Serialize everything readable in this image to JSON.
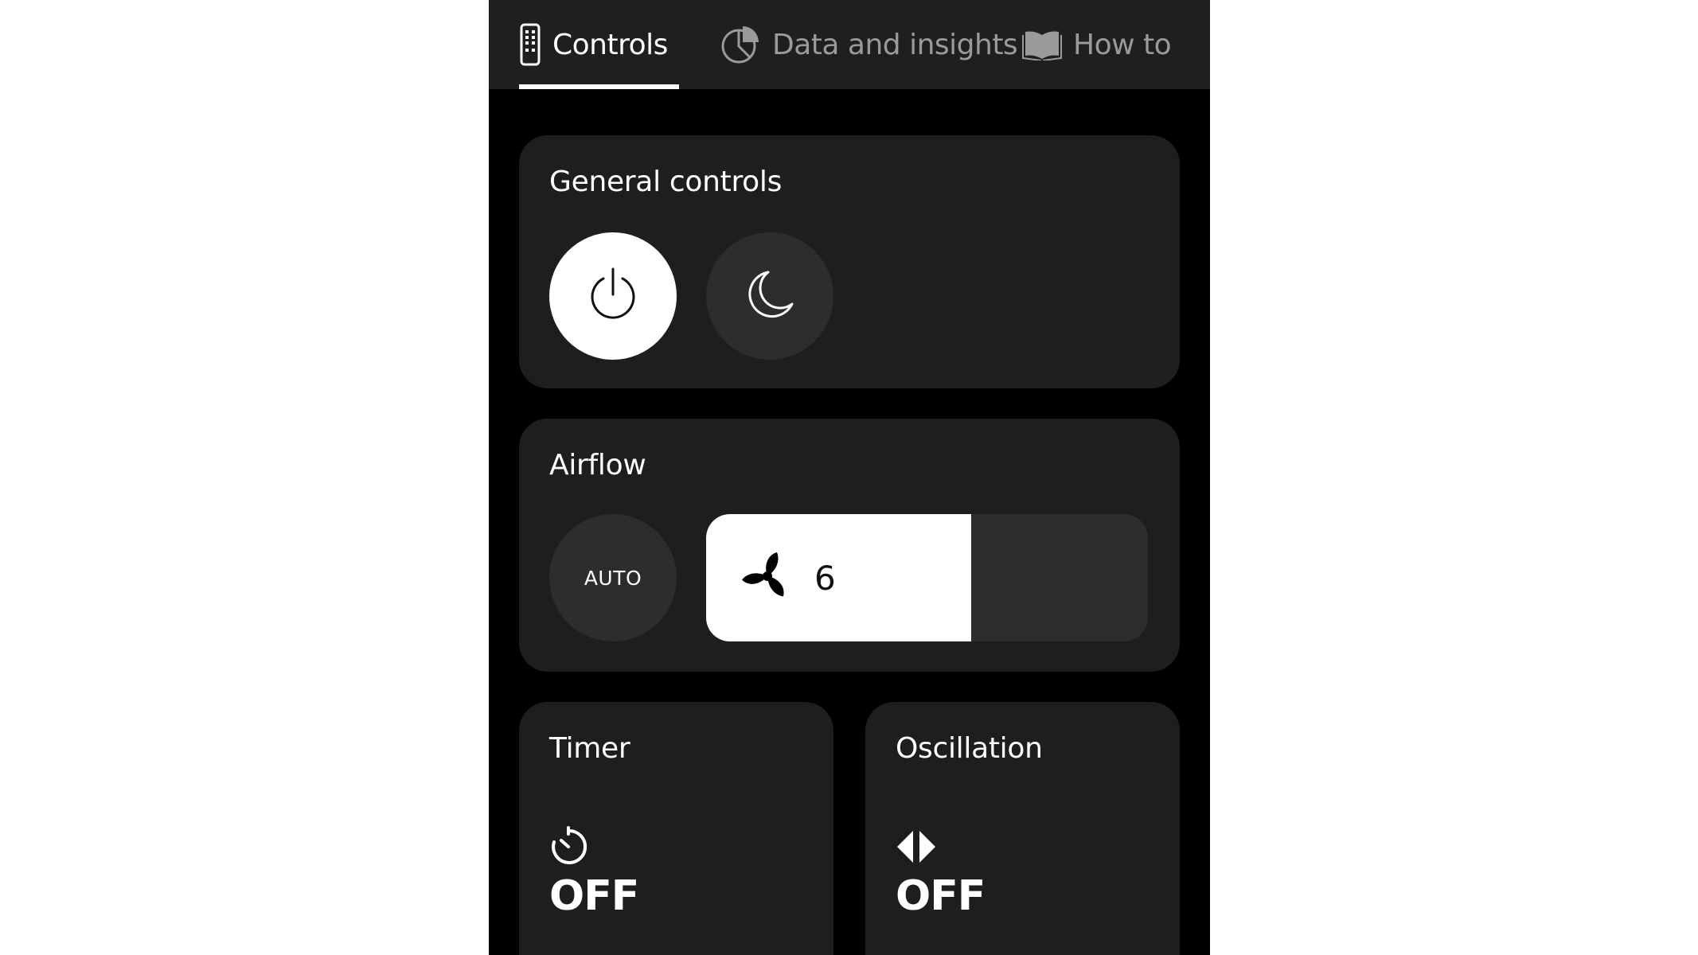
{
  "tabs": [
    {
      "label": "Controls",
      "icon": "remote-icon",
      "active": true
    },
    {
      "label": "Data and insights",
      "icon": "pie-chart-icon",
      "active": false
    },
    {
      "label": "How to",
      "icon": "book-icon",
      "active": false
    }
  ],
  "general": {
    "title": "General controls",
    "power_icon": "power-icon",
    "night_icon": "moon-icon"
  },
  "airflow": {
    "title": "Airflow",
    "auto_label": "AUTO",
    "speed": "6",
    "level_fraction": 0.6,
    "fan_icon": "fan-icon"
  },
  "timer": {
    "title": "Timer",
    "value": "OFF",
    "icon": "timer-icon"
  },
  "oscillation": {
    "title": "Oscillation",
    "value": "OFF",
    "icon": "oscillation-icon"
  },
  "colors": {
    "background": "#000000",
    "card": "#1e1e1e",
    "button_dark": "#2d2d2d",
    "active": "#ffffff",
    "inactive_text": "#9a9a9a"
  }
}
